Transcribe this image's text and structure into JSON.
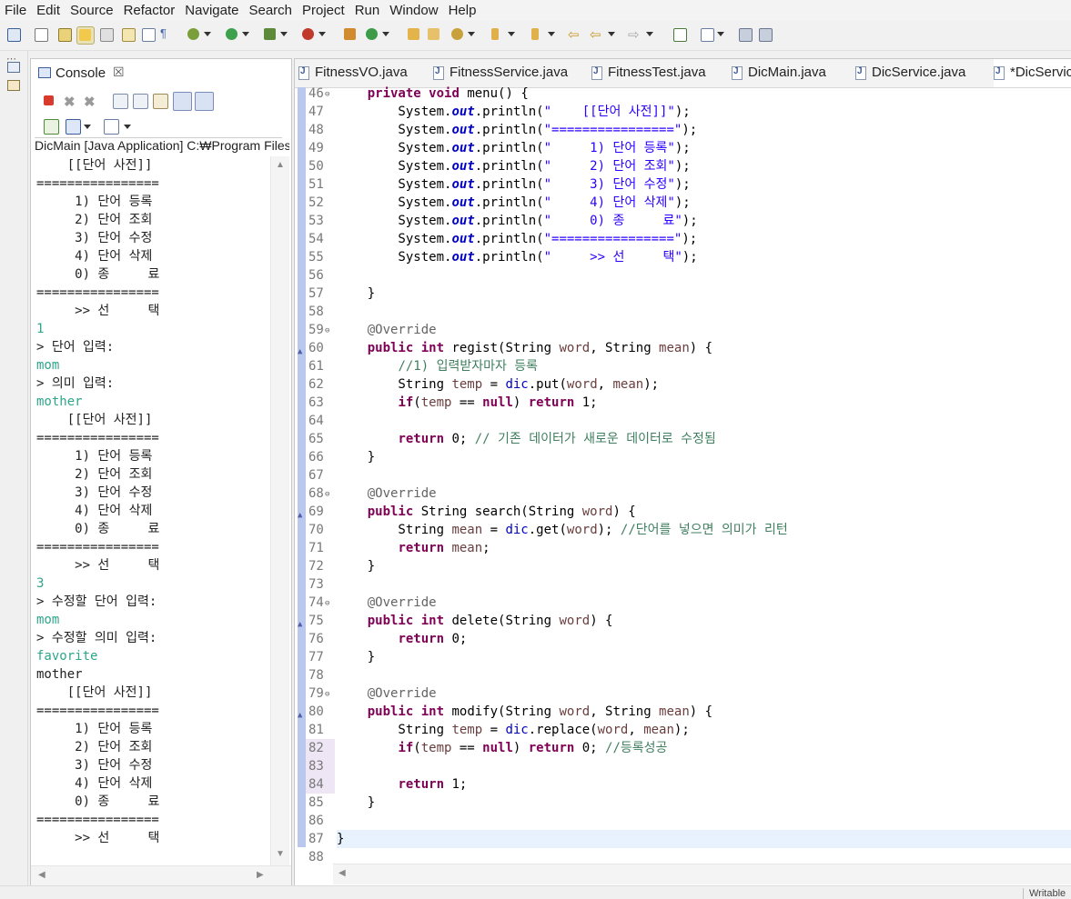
{
  "menu": [
    "File",
    "Edit",
    "Source",
    "Refactor",
    "Navigate",
    "Search",
    "Project",
    "Run",
    "Window",
    "Help"
  ],
  "console": {
    "tab_label": "Console",
    "close_glyph": "☒",
    "launch_title": "DicMain [Java Application] C:₩Program Files",
    "lines": [
      {
        "text": "    [[단어 사전]]",
        "input": false
      },
      {
        "text": "================",
        "input": false
      },
      {
        "text": "     1) 단어 등록",
        "input": false
      },
      {
        "text": "     2) 단어 조회",
        "input": false
      },
      {
        "text": "     3) 단어 수정",
        "input": false
      },
      {
        "text": "     4) 단어 삭제",
        "input": false
      },
      {
        "text": "     0) 종     료",
        "input": false
      },
      {
        "text": "================",
        "input": false
      },
      {
        "text": "     >> 선     택",
        "input": false
      },
      {
        "text": "1",
        "input": true
      },
      {
        "text": "> 단어 입력:",
        "input": false
      },
      {
        "text": "mom",
        "input": true
      },
      {
        "text": "> 의미 입력:",
        "input": false
      },
      {
        "text": "mother",
        "input": true
      },
      {
        "text": "    [[단어 사전]]",
        "input": false
      },
      {
        "text": "================",
        "input": false
      },
      {
        "text": "     1) 단어 등록",
        "input": false
      },
      {
        "text": "     2) 단어 조회",
        "input": false
      },
      {
        "text": "     3) 단어 수정",
        "input": false
      },
      {
        "text": "     4) 단어 삭제",
        "input": false
      },
      {
        "text": "     0) 종     료",
        "input": false
      },
      {
        "text": "================",
        "input": false
      },
      {
        "text": "     >> 선     택",
        "input": false
      },
      {
        "text": "3",
        "input": true
      },
      {
        "text": "> 수정할 단어 입력:",
        "input": false
      },
      {
        "text": "mom",
        "input": true
      },
      {
        "text": "> 수정할 의미 입력:",
        "input": false
      },
      {
        "text": "favorite",
        "input": true
      },
      {
        "text": "mother",
        "input": false
      },
      {
        "text": "    [[단어 사전]]",
        "input": false
      },
      {
        "text": "================",
        "input": false
      },
      {
        "text": "     1) 단어 등록",
        "input": false
      },
      {
        "text": "     2) 단어 조회",
        "input": false
      },
      {
        "text": "     3) 단어 수정",
        "input": false
      },
      {
        "text": "     4) 단어 삭제",
        "input": false
      },
      {
        "text": "     0) 종     료",
        "input": false
      },
      {
        "text": "================",
        "input": false
      },
      {
        "text": "     >> 선     택",
        "input": false
      }
    ]
  },
  "editor": {
    "tabs": [
      {
        "label": "FitnessVO.java",
        "active": false
      },
      {
        "label": "FitnessService.java",
        "active": false
      },
      {
        "label": "FitnessTest.java",
        "active": false
      },
      {
        "label": "DicMain.java",
        "active": false
      },
      {
        "label": "DicService.java",
        "active": false
      },
      {
        "label": "*DicServiceImpl.java",
        "active": true
      }
    ],
    "lines": [
      {
        "n": "46",
        "fold": true,
        "override": false,
        "highlight": false,
        "current": false,
        "html": "    <span class='k'>private</span> <span class='k'>void</span> menu() {"
      },
      {
        "n": "47",
        "fold": false,
        "override": false,
        "highlight": false,
        "current": false,
        "html": "        System.<span class='fi'>out</span>.println(<span class='s'>\"    [[단어 사전]]\"</span>);"
      },
      {
        "n": "48",
        "fold": false,
        "override": false,
        "highlight": false,
        "current": false,
        "html": "        System.<span class='fi'>out</span>.println(<span class='s'>\"================\"</span>);"
      },
      {
        "n": "49",
        "fold": false,
        "override": false,
        "highlight": false,
        "current": false,
        "html": "        System.<span class='fi'>out</span>.println(<span class='s'>\"     1) 단어 등록\"</span>);"
      },
      {
        "n": "50",
        "fold": false,
        "override": false,
        "highlight": false,
        "current": false,
        "html": "        System.<span class='fi'>out</span>.println(<span class='s'>\"     2) 단어 조회\"</span>);"
      },
      {
        "n": "51",
        "fold": false,
        "override": false,
        "highlight": false,
        "current": false,
        "html": "        System.<span class='fi'>out</span>.println(<span class='s'>\"     3) 단어 수정\"</span>);"
      },
      {
        "n": "52",
        "fold": false,
        "override": false,
        "highlight": false,
        "current": false,
        "html": "        System.<span class='fi'>out</span>.println(<span class='s'>\"     4) 단어 삭제\"</span>);"
      },
      {
        "n": "53",
        "fold": false,
        "override": false,
        "highlight": false,
        "current": false,
        "html": "        System.<span class='fi'>out</span>.println(<span class='s'>\"     0) 종     료\"</span>);"
      },
      {
        "n": "54",
        "fold": false,
        "override": false,
        "highlight": false,
        "current": false,
        "html": "        System.<span class='fi'>out</span>.println(<span class='s'>\"================\"</span>);"
      },
      {
        "n": "55",
        "fold": false,
        "override": false,
        "highlight": false,
        "current": false,
        "html": "        System.<span class='fi'>out</span>.println(<span class='s'>\"     >> 선     택\"</span>);"
      },
      {
        "n": "56",
        "fold": false,
        "override": false,
        "highlight": false,
        "current": false,
        "html": ""
      },
      {
        "n": "57",
        "fold": false,
        "override": false,
        "highlight": false,
        "current": false,
        "html": "    }"
      },
      {
        "n": "58",
        "fold": false,
        "override": false,
        "highlight": false,
        "current": false,
        "html": ""
      },
      {
        "n": "59",
        "fold": true,
        "override": false,
        "highlight": false,
        "current": false,
        "html": "    <span class='a'>@Override</span>"
      },
      {
        "n": "60",
        "fold": false,
        "override": true,
        "highlight": false,
        "current": false,
        "html": "    <span class='k'>public</span> <span class='k'>int</span> regist(String <span class='v'>word</span>, String <span class='v'>mean</span>) {"
      },
      {
        "n": "61",
        "fold": false,
        "override": false,
        "highlight": false,
        "current": false,
        "html": "        <span class='c'>//1) 입력받자마자 등록</span>"
      },
      {
        "n": "62",
        "fold": false,
        "override": false,
        "highlight": false,
        "current": false,
        "html": "        String <span class='v'>temp</span> = <span class='f'>dic</span>.put(<span class='v'>word</span>, <span class='v'>mean</span>);"
      },
      {
        "n": "63",
        "fold": false,
        "override": false,
        "highlight": false,
        "current": false,
        "html": "        <span class='k'>if</span>(<span class='v'>temp</span> == <span class='k'>null</span>) <span class='k'>return</span> 1;"
      },
      {
        "n": "64",
        "fold": false,
        "override": false,
        "highlight": false,
        "current": false,
        "html": ""
      },
      {
        "n": "65",
        "fold": false,
        "override": false,
        "highlight": false,
        "current": false,
        "html": "        <span class='k'>return</span> 0; <span class='c'>// 기존 데이터가 새로운 데이터로 수정됨</span>"
      },
      {
        "n": "66",
        "fold": false,
        "override": false,
        "highlight": false,
        "current": false,
        "html": "    }"
      },
      {
        "n": "67",
        "fold": false,
        "override": false,
        "highlight": false,
        "current": false,
        "html": ""
      },
      {
        "n": "68",
        "fold": true,
        "override": false,
        "highlight": false,
        "current": false,
        "html": "    <span class='a'>@Override</span>"
      },
      {
        "n": "69",
        "fold": false,
        "override": true,
        "highlight": false,
        "current": false,
        "html": "    <span class='k'>public</span> String search(String <span class='v'>word</span>) {"
      },
      {
        "n": "70",
        "fold": false,
        "override": false,
        "highlight": false,
        "current": false,
        "html": "        String <span class='v'>mean</span> = <span class='f'>dic</span>.get(<span class='v'>word</span>); <span class='c'>//단어를 넣으면 의미가 리턴</span>"
      },
      {
        "n": "71",
        "fold": false,
        "override": false,
        "highlight": false,
        "current": false,
        "html": "        <span class='k'>return</span> <span class='v'>mean</span>;"
      },
      {
        "n": "72",
        "fold": false,
        "override": false,
        "highlight": false,
        "current": false,
        "html": "    }"
      },
      {
        "n": "73",
        "fold": false,
        "override": false,
        "highlight": false,
        "current": false,
        "html": ""
      },
      {
        "n": "74",
        "fold": true,
        "override": false,
        "highlight": false,
        "current": false,
        "html": "    <span class='a'>@Override</span>"
      },
      {
        "n": "75",
        "fold": false,
        "override": true,
        "highlight": false,
        "current": false,
        "html": "    <span class='k'>public</span> <span class='k'>int</span> delete(String <span class='v'>word</span>) {"
      },
      {
        "n": "76",
        "fold": false,
        "override": false,
        "highlight": false,
        "current": false,
        "html": "        <span class='k'>return</span> 0;"
      },
      {
        "n": "77",
        "fold": false,
        "override": false,
        "highlight": false,
        "current": false,
        "html": "    }"
      },
      {
        "n": "78",
        "fold": false,
        "override": false,
        "highlight": false,
        "current": false,
        "html": ""
      },
      {
        "n": "79",
        "fold": true,
        "override": false,
        "highlight": false,
        "current": false,
        "html": "    <span class='a'>@Override</span>"
      },
      {
        "n": "80",
        "fold": false,
        "override": true,
        "highlight": false,
        "current": false,
        "html": "    <span class='k'>public</span> <span class='k'>int</span> modify(String <span class='v'>word</span>, String <span class='v'>mean</span>) {"
      },
      {
        "n": "81",
        "fold": false,
        "override": false,
        "highlight": false,
        "current": false,
        "html": "        String <span class='v'>temp</span> = <span class='f'>dic</span>.replace(<span class='v'>word</span>, <span class='v'>mean</span>);"
      },
      {
        "n": "82",
        "fold": false,
        "override": false,
        "highlight": true,
        "current": false,
        "html": "        <span class='k'>if</span>(<span class='v'>temp</span> == <span class='k'>null</span>) <span class='k'>return</span> 0; <span class='c'>//등록성공</span>"
      },
      {
        "n": "83",
        "fold": false,
        "override": false,
        "highlight": true,
        "current": false,
        "html": ""
      },
      {
        "n": "84",
        "fold": false,
        "override": false,
        "highlight": true,
        "current": false,
        "html": "        <span class='k'>return</span> 1;"
      },
      {
        "n": "85",
        "fold": false,
        "override": false,
        "highlight": false,
        "current": false,
        "html": "    }"
      },
      {
        "n": "86",
        "fold": false,
        "override": false,
        "highlight": false,
        "current": false,
        "html": ""
      },
      {
        "n": "87",
        "fold": false,
        "override": false,
        "highlight": false,
        "current": true,
        "html": "}"
      },
      {
        "n": "88",
        "fold": false,
        "override": false,
        "highlight": false,
        "current": false,
        "html": ""
      }
    ]
  },
  "status": {
    "text": "Writable"
  },
  "colors": {
    "keyword": "#7f0055",
    "string": "#2a00ff",
    "comment": "#3f7f5f",
    "field": "#0000c0",
    "console_input": "#2fa58a"
  }
}
